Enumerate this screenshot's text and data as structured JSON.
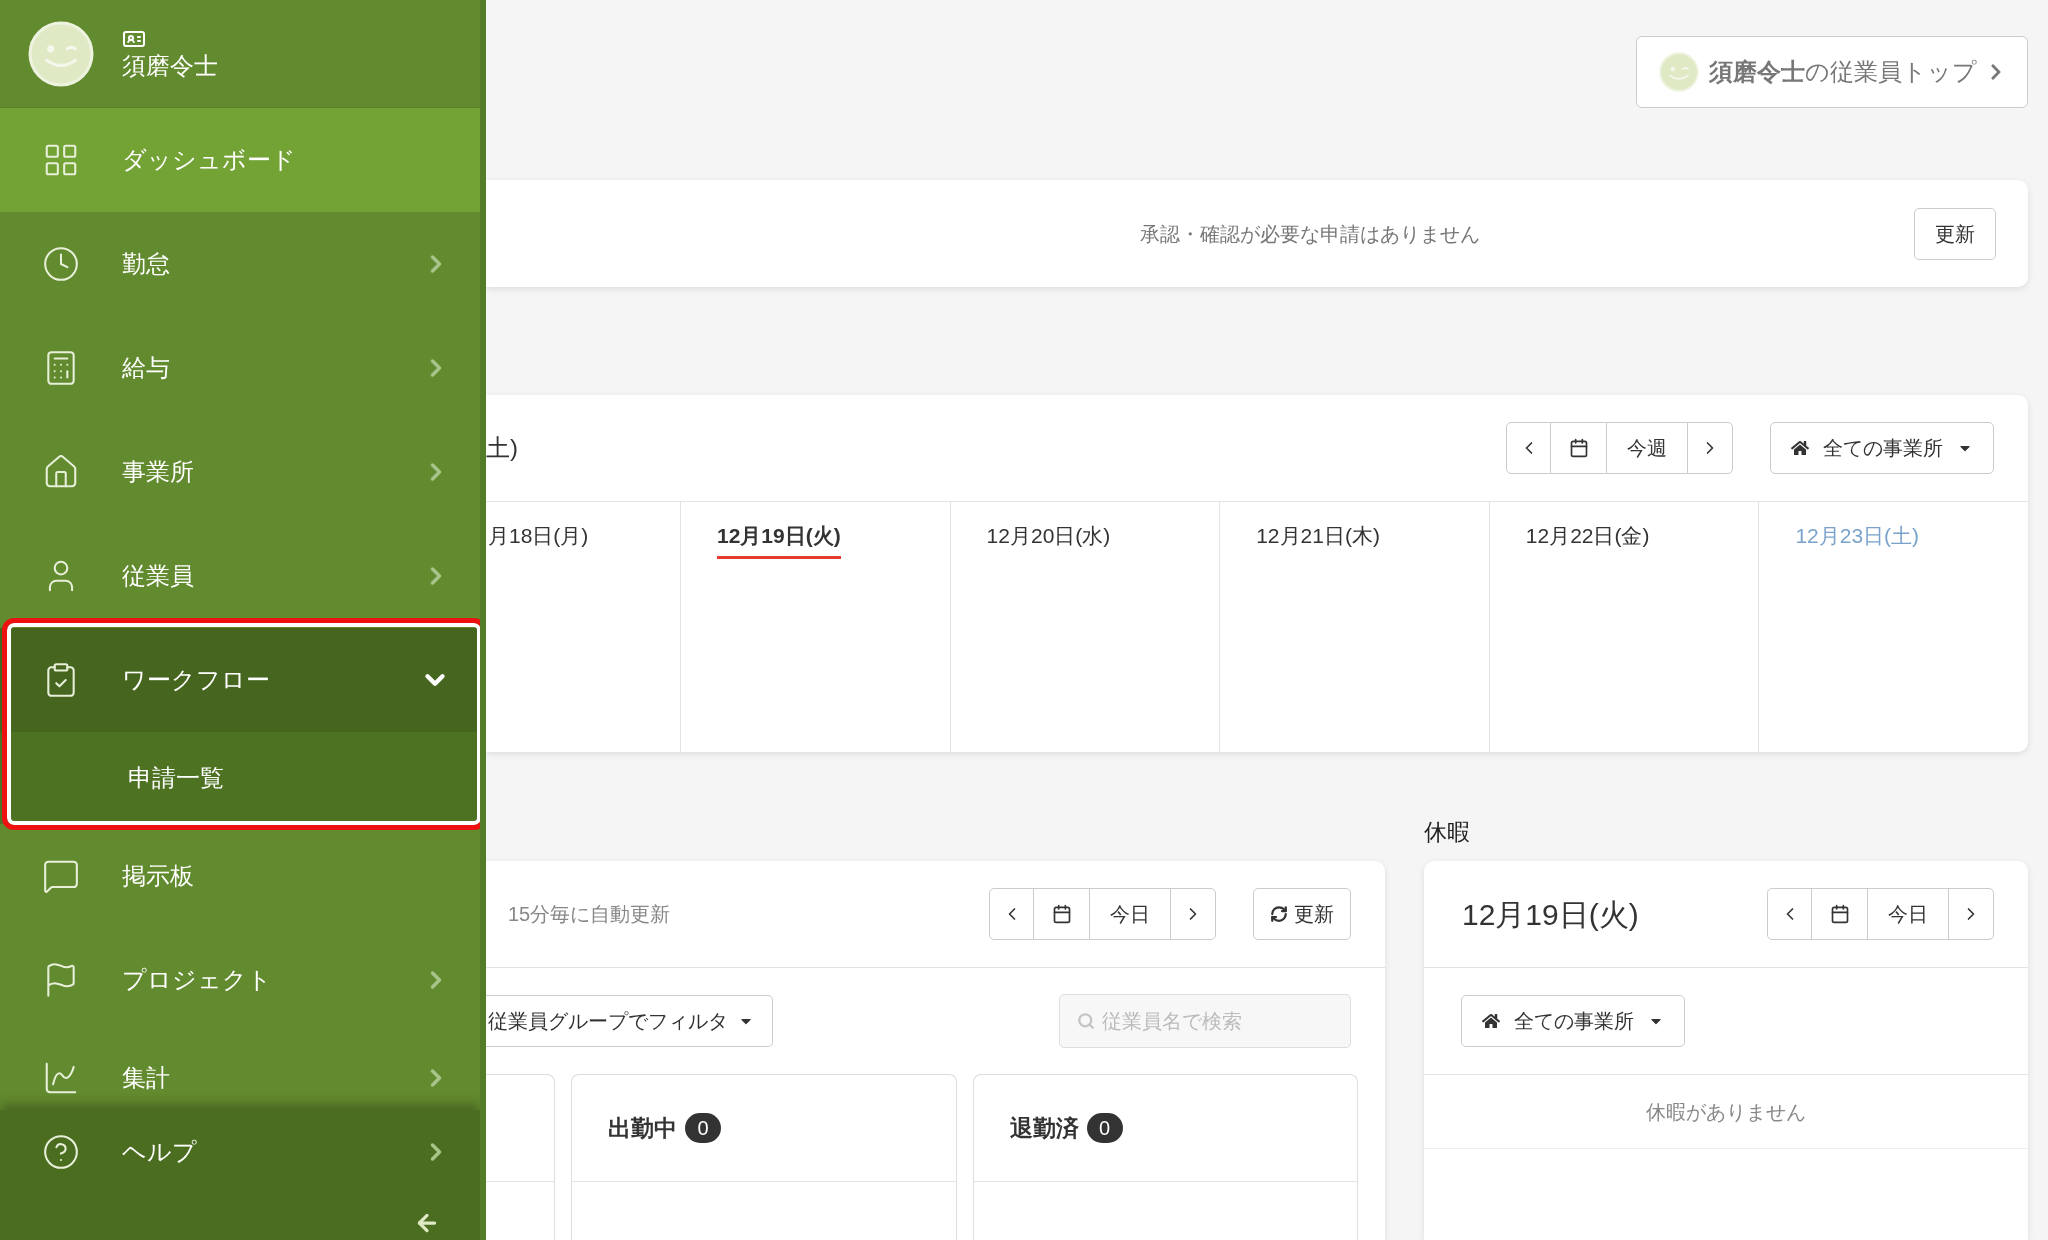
{
  "user": {
    "name": "須磨令士"
  },
  "sidebar": {
    "items": [
      {
        "label": "ダッシュボード",
        "kind": "link",
        "selected": true
      },
      {
        "label": "勤怠",
        "kind": "menu",
        "selected": false,
        "expanded": false
      },
      {
        "label": "給与",
        "kind": "menu",
        "selected": false,
        "expanded": false
      },
      {
        "label": "事業所",
        "kind": "menu",
        "selected": false,
        "expanded": false
      },
      {
        "label": "従業員",
        "kind": "menu",
        "selected": false,
        "expanded": false
      },
      {
        "label": "ワークフロー",
        "kind": "menu",
        "selected": false,
        "expanded": true,
        "highlighted": true,
        "children": [
          {
            "label": "申請一覧",
            "selected": false
          }
        ]
      },
      {
        "label": "掲示板",
        "kind": "link",
        "selected": false
      },
      {
        "label": "プロジェクト",
        "kind": "menu",
        "selected": false,
        "expanded": false
      },
      {
        "label": "集計",
        "kind": "menu",
        "selected": false,
        "expanded": false
      }
    ],
    "help": {
      "label": "ヘルプ",
      "kind": "menu",
      "expanded": false
    }
  },
  "top_link": {
    "text": "**須磨令士**の従業員トップ"
  },
  "approvals": {
    "message": "承認・確認が必要な申請はありません",
    "button": "更新"
  },
  "week": {
    "title": "土)",
    "nav_button": "今週",
    "office_filter": "全ての事業所",
    "days": [
      {
        "label": "月18日(月)",
        "selected": false,
        "kind": "weekday"
      },
      {
        "label": "12月19日(火)",
        "selected": true,
        "kind": "weekday"
      },
      {
        "label": "12月20日(水)",
        "selected": false,
        "kind": "weekday"
      },
      {
        "label": "12月21日(木)",
        "selected": false,
        "kind": "weekday"
      },
      {
        "label": "12月22日(金)",
        "selected": false,
        "kind": "weekday"
      },
      {
        "label": "12月23日(土)",
        "selected": false,
        "kind": "saturday"
      }
    ]
  },
  "attendance": {
    "auto_update": "15分毎に自動更新",
    "nav_button": "今日",
    "refresh": "更新",
    "group_filter": "従業員グループでフィルタ",
    "search_placeholder": "従業員名で検索",
    "columns": [
      {
        "title": "出勤中",
        "count": "0"
      },
      {
        "title": "退勤済",
        "count": "0"
      }
    ]
  },
  "leave": {
    "heading": "休暇",
    "date": "12月19日(火)",
    "nav_button": "今日",
    "office_filter": "全ての事業所",
    "empty": "休暇がありません"
  }
}
